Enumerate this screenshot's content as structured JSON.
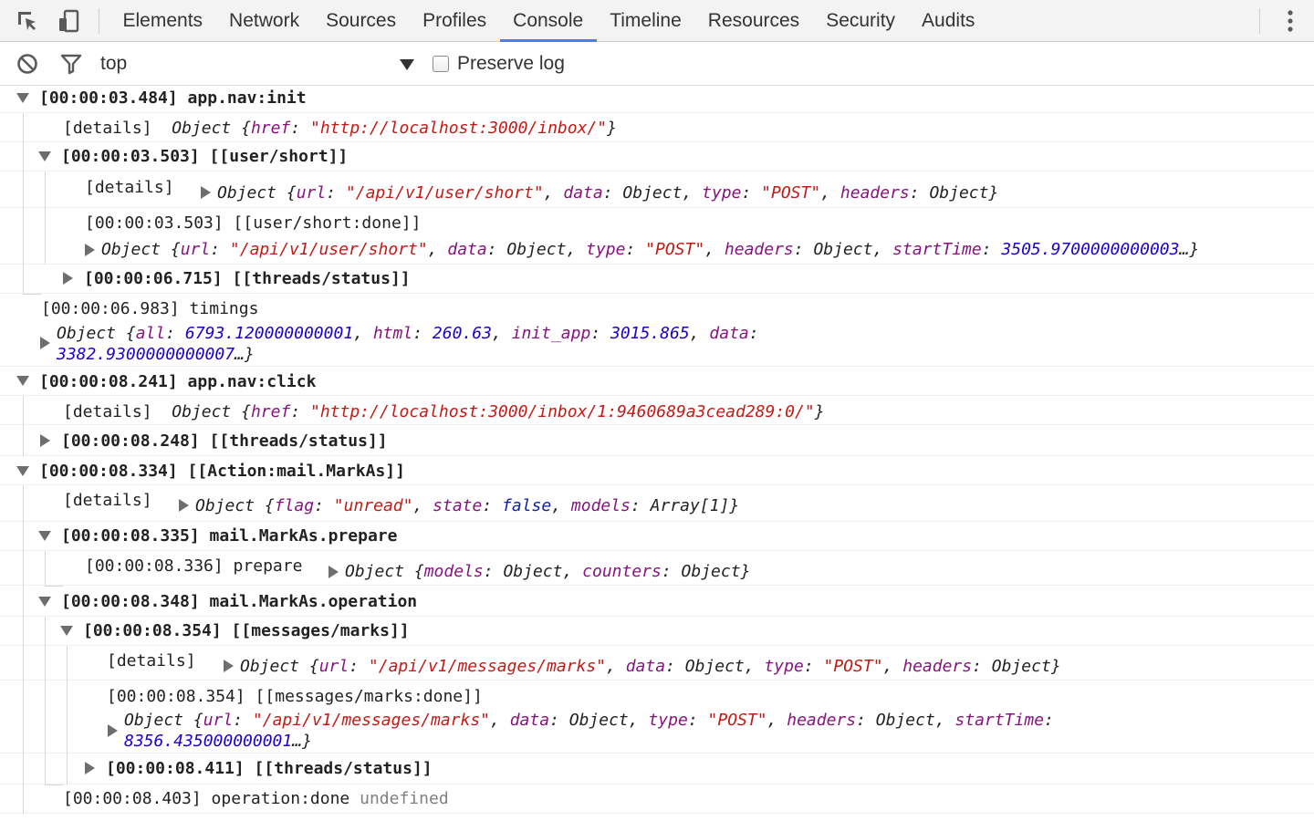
{
  "devtools": {
    "tabs": [
      {
        "label": "Elements"
      },
      {
        "label": "Network"
      },
      {
        "label": "Sources"
      },
      {
        "label": "Profiles"
      },
      {
        "label": "Console",
        "active": true
      },
      {
        "label": "Timeline"
      },
      {
        "label": "Resources"
      },
      {
        "label": "Security"
      },
      {
        "label": "Audits"
      }
    ],
    "icons": {
      "inspect": "inspect-element-icon",
      "device": "device-mode-icon",
      "menu": "more-options-icon"
    }
  },
  "toolbar": {
    "context": "top",
    "preserve_log_label": "Preserve log",
    "preserve_log_checked": false,
    "icons": {
      "clear": "clear-console-icon",
      "filter": "filter-icon"
    }
  },
  "console": {
    "lines": [
      {
        "prefix": "[00:00:03.484] app.nav:init"
      },
      {
        "prefix": "[details]",
        "href": "\"http://localhost:3000/inbox/\""
      },
      {
        "prefix": "[00:00:03.503] [[user/short]]"
      },
      {
        "prefix": "[details]",
        "url": "\"/api/v1/user/short\"",
        "type": "\"POST\""
      },
      {
        "prefix": "[00:00:03.503] [[user/short:done]]",
        "url": "\"/api/v1/user/short\"",
        "type": "\"POST\"",
        "startTime": "3505.9700000000003"
      },
      {
        "prefix": "[00:00:06.715] [[threads/status]]"
      },
      {
        "prefix": "[00:00:06.983] timings",
        "all": "6793.120000000001",
        "html": "260.63",
        "init_app": "3015.865",
        "data": "3382.9300000000007"
      },
      {
        "prefix": "[00:00:08.241] app.nav:click"
      },
      {
        "prefix": "[details]",
        "href": "\"http://localhost:3000/inbox/1:9460689a3cead289:0/\""
      },
      {
        "prefix": "[00:00:08.248] [[threads/status]]"
      },
      {
        "prefix": "[00:00:08.334] [[Action:mail.MarkAs]]"
      },
      {
        "prefix": "[details]",
        "flag": "\"unread\"",
        "state": "false",
        "models": "Array[1]"
      },
      {
        "prefix": "[00:00:08.335] mail.MarkAs.prepare"
      },
      {
        "prefix": "[00:00:08.336] prepare"
      },
      {
        "prefix": "[00:00:08.348] mail.MarkAs.operation"
      },
      {
        "prefix": "[00:00:08.354] [[messages/marks]]"
      },
      {
        "prefix": "[details]",
        "url": "\"/api/v1/messages/marks\"",
        "type": "\"POST\""
      },
      {
        "prefix": "[00:00:08.354] [[messages/marks:done]]",
        "url": "\"/api/v1/messages/marks\"",
        "type": "\"POST\"",
        "startTime": "8356.435000000001"
      },
      {
        "prefix": "[00:00:08.411] [[threads/status]]"
      },
      {
        "prefix": "[00:00:08.403] operation:done",
        "value": "undefined"
      }
    ],
    "tokens": {
      "object": "Object",
      "k_href": "href",
      "k_url": "url",
      "k_data": "data",
      "k_type": "type",
      "k_headers": "headers",
      "k_startTime": "startTime",
      "k_all": "all",
      "k_html": "html",
      "k_init_app": "init_app",
      "k_flag": "flag",
      "k_state": "state",
      "k_models": "models",
      "k_counters": "counters",
      "ellipsis": "…"
    }
  }
}
